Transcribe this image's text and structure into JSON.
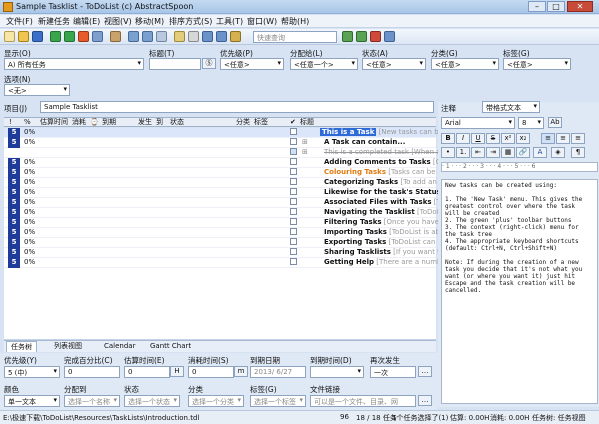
{
  "window": {
    "title": "Sample Tasklist - ToDoList (c) AbstractSpoon",
    "min_glyph": "–",
    "max_glyph": "□",
    "close_glyph": "✕"
  },
  "menu": [
    "文件(F)",
    "新建任务",
    "编辑(E)",
    "视图(V)",
    "移动(M)",
    "排序方式(S)",
    "工具(T)",
    "窗口(W)",
    "帮助(H)"
  ],
  "toolbar": {
    "search_placeholder": "快速查询"
  },
  "filters": {
    "display": {
      "label": "显示(O)",
      "value": "A) 所有任务"
    },
    "title": {
      "label": "标题(T)",
      "value": ""
    },
    "priority": {
      "label": "优先级(P)",
      "value": "<任意>"
    },
    "assigned": {
      "label": "分配给(L)",
      "value": "<任意一个>"
    },
    "status": {
      "label": "状态(A)",
      "value": "<任意>"
    },
    "category": {
      "label": "分类(G)",
      "value": "<任意>"
    },
    "tags": {
      "label": "标签(G)",
      "value": "<任意>"
    },
    "options": {
      "label": "选项(N)",
      "value": "<无>"
    }
  },
  "project": {
    "label": "项目(J)",
    "value": "Sample Tasklist"
  },
  "notes_header": {
    "label": "注释",
    "format": "带格式文本"
  },
  "notes_toolbar": {
    "font": "Arial",
    "size": "8"
  },
  "grid": {
    "headers": [
      "!",
      "%",
      "估算时间",
      "消耗",
      "⌚",
      "到期",
      "发生",
      "到",
      "状态",
      "分类",
      "标签",
      "✔",
      "标题"
    ],
    "rows": [
      {
        "prio": "5",
        "pct": "0%",
        "title": "This is a Task",
        "comment": "[New tasks can be crea"
      },
      {
        "prio": "5",
        "pct": "0%",
        "title": "A Task can contain...",
        "comment": ""
      },
      {
        "prio": "",
        "pct": "",
        "title": "This is a completed task",
        "comment": "[When a task is"
      },
      {
        "prio": "5",
        "pct": "0%",
        "title": "Adding Comments to Tasks",
        "comment": "[Comme"
      },
      {
        "prio": "5",
        "pct": "0%",
        "title": "Colouring Tasks",
        "comment": "[Tasks can be colou"
      },
      {
        "prio": "5",
        "pct": "0%",
        "title": "Categorizing Tasks",
        "comment": "[To add an catego"
      },
      {
        "prio": "5",
        "pct": "0%",
        "title": "Likewise for the task's Status, Alloc",
        "comment": ""
      },
      {
        "prio": "5",
        "pct": "0%",
        "title": "Associated Files with Tasks",
        "comment": "[The Fil"
      },
      {
        "prio": "5",
        "pct": "0%",
        "title": "Navigating the Tasklist",
        "comment": "[ToDoList can"
      },
      {
        "prio": "5",
        "pct": "0%",
        "title": "Filtering Tasks",
        "comment": "[Once you have been"
      },
      {
        "prio": "5",
        "pct": "0%",
        "title": "Importing Tasks",
        "comment": "[ToDoList is able to im"
      },
      {
        "prio": "5",
        "pct": "0%",
        "title": "Exporting Tasks",
        "comment": "[ToDoList can export"
      },
      {
        "prio": "5",
        "pct": "0%",
        "title": "Sharing Tasklists",
        "comment": "[If you want to coll"
      },
      {
        "prio": "5",
        "pct": "0%",
        "title": "Getting Help",
        "comment": "[There are a number of"
      }
    ]
  },
  "notes_text": "New tasks can be created using:\n\n1. The 'New Task' menu. This gives the\ngreatest control over where the task\nwill be created\n2. The green 'plus' toolbar buttons\n3. The context (right-click) menu for\nthe task tree\n4. The appropriate keyboard shortcuts\n(default: Ctrl+N, Ctrl+Shift+N)\n\nNote: If during the creation of a new\ntask you decide that it's not what you\nwant (or where you want it) just hit\nEscape and the task creation will be\ncancelled.",
  "tabs": [
    "任务树",
    "列表视图",
    "Calendar",
    "Gantt Chart"
  ],
  "fields": {
    "priority": {
      "label": "优先级(Y)",
      "value": "5 (中)"
    },
    "percent": {
      "label": "完成百分比(C)",
      "value": "0"
    },
    "estimate": {
      "label": "估算时间(E)",
      "value": "0",
      "unit": "H"
    },
    "spent": {
      "label": "消耗时间(S)",
      "value": "0",
      "unit": "m"
    },
    "start": {
      "label": "到期日期",
      "value": "2013/ 6/27"
    },
    "due": {
      "label": "到期时间(D)",
      "value": ""
    },
    "recur": {
      "label": "再次发生",
      "value": "一次"
    },
    "color": {
      "label": "颜色",
      "value": "单一文本"
    },
    "assigned": {
      "label": "分配到",
      "value": "选择一个名称"
    },
    "status": {
      "label": "状态",
      "value": "选择一个状态"
    },
    "category": {
      "label": "分类",
      "value": "选择一个分类"
    },
    "tags": {
      "label": "标签(G)",
      "value": "选择一个标签"
    },
    "file": {
      "label": "文件链接",
      "value": "可以是一个文件、目录、网"
    }
  },
  "statusbar": {
    "path": "E:\\极速下载\\ToDoList\\Resources\\TaskLists\\Introduction.tdl",
    "count": "96",
    "tasks": "18 / 18 任务",
    "selected": "1个任务选择了(1)",
    "estimate": "估算: 0.00H",
    "spent": "消耗: 0.00H",
    "view": "任务树: 任务视图"
  },
  "colors": {
    "priority_cell": "#1f3b9a",
    "selected_title_bg": "#2f6bd6",
    "colouring_text": "#e07a10"
  }
}
